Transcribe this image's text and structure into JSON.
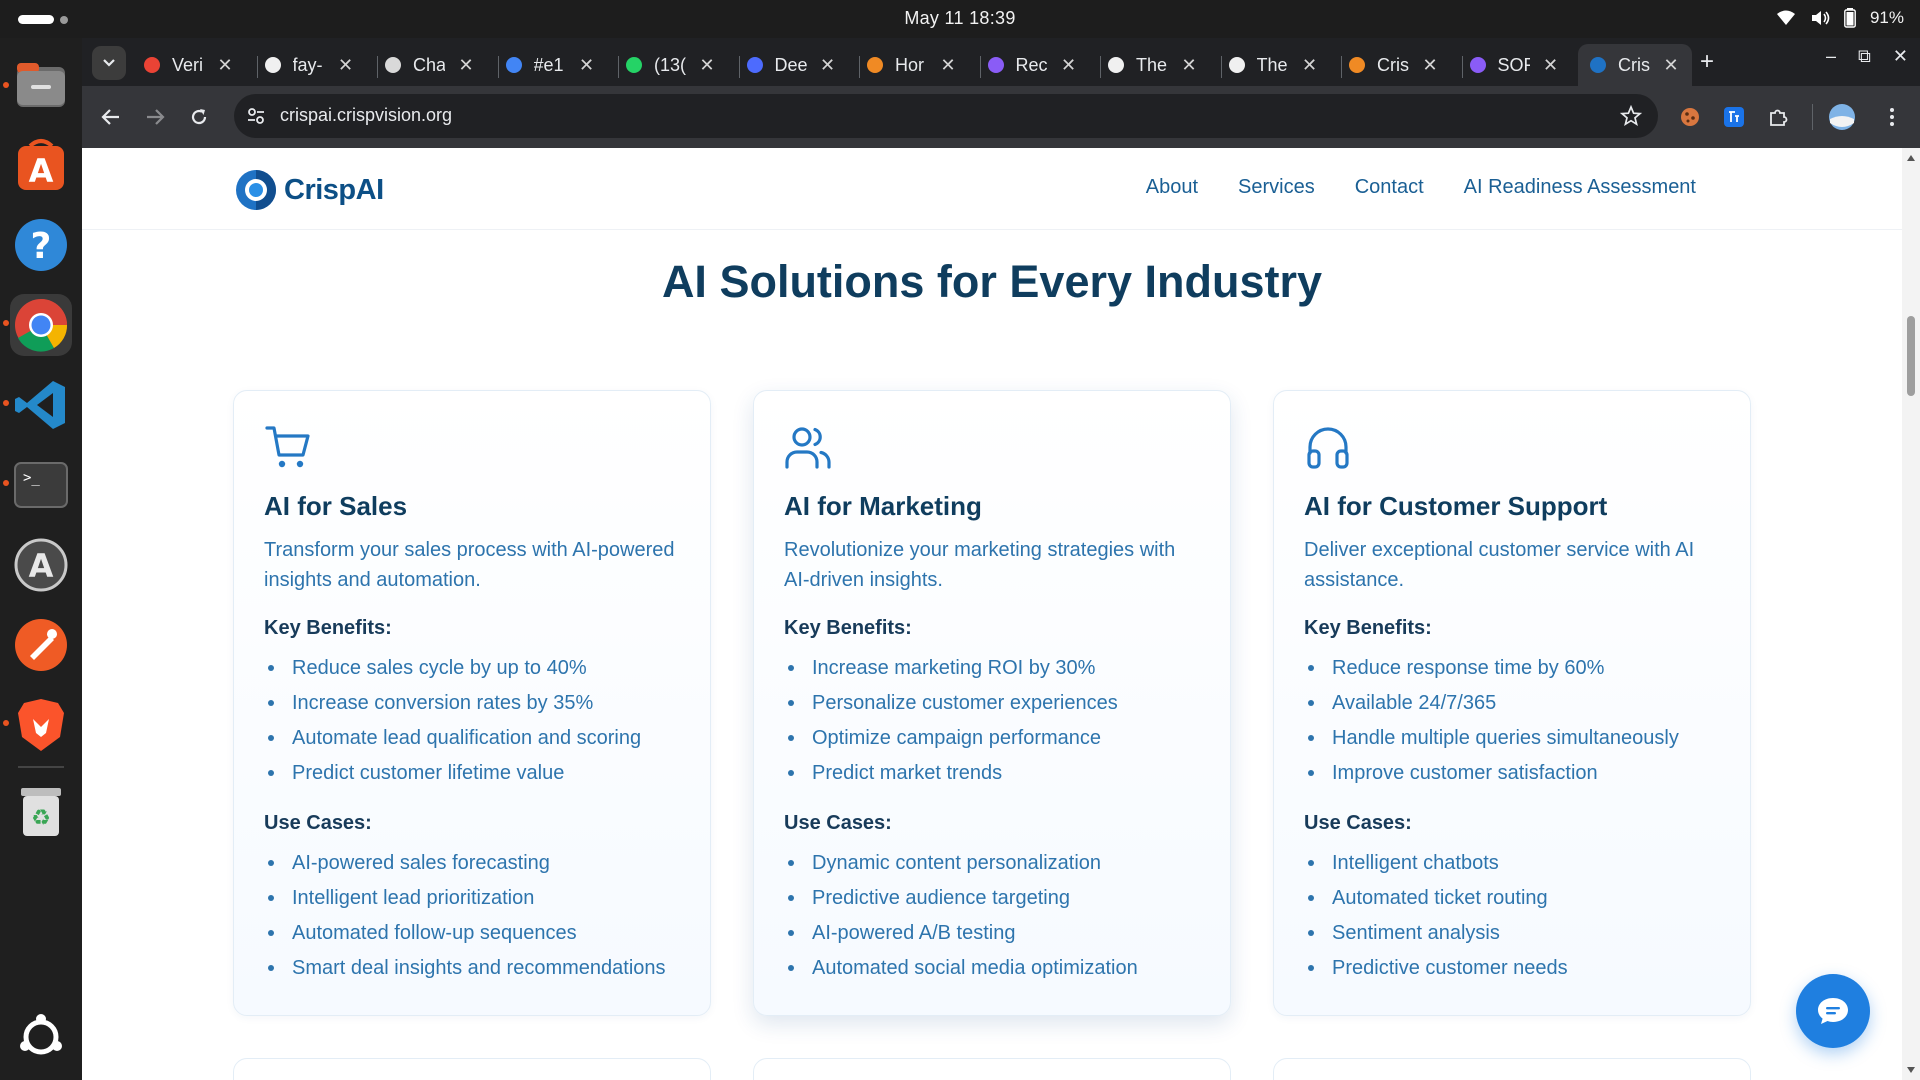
{
  "system": {
    "clock": "May 11  18:39",
    "battery": "91%"
  },
  "browser": {
    "tabs": [
      {
        "title": "Veri",
        "icon": "gmail-icon"
      },
      {
        "title": "fay-",
        "icon": "github-icon"
      },
      {
        "title": "Cha",
        "icon": "chatgpt-icon"
      },
      {
        "title": "#e1",
        "icon": "google-icon"
      },
      {
        "title": "(13(",
        "icon": "whatsapp-icon"
      },
      {
        "title": "Dee",
        "icon": "deepseek-icon"
      },
      {
        "title": "Hor",
        "icon": "site-icon"
      },
      {
        "title": "Rec",
        "icon": "purple-app-icon"
      },
      {
        "title": "The",
        "icon": "chat-bubble-icon"
      },
      {
        "title": "The",
        "icon": "chat-bubble-icon"
      },
      {
        "title": "Cris",
        "icon": "site-icon"
      },
      {
        "title": "SOF",
        "icon": "purple-app-icon"
      },
      {
        "title": "Cris",
        "icon": "crispai-icon",
        "active": true
      }
    ],
    "url": "crispai.crispvision.org"
  },
  "site": {
    "logo_text": "CrispAI",
    "nav": [
      "About",
      "Services",
      "Contact",
      "AI Readiness Assessment"
    ],
    "section_title": "AI Solutions for Every Industry",
    "benefits_heading": "Key Benefits:",
    "usecases_heading": "Use Cases:",
    "cards": [
      {
        "icon": "cart-icon",
        "title": "AI for Sales",
        "description": "Transform your sales process with AI-powered insights and automation.",
        "benefits": [
          "Reduce sales cycle by up to 40%",
          "Increase conversion rates by 35%",
          "Automate lead qualification and scoring",
          "Predict customer lifetime value"
        ],
        "use_cases": [
          "AI-powered sales forecasting",
          "Intelligent lead prioritization",
          "Automated follow-up sequences",
          "Smart deal insights and recommendations"
        ]
      },
      {
        "icon": "users-icon",
        "title": "AI for Marketing",
        "description": "Revolutionize your marketing strategies with AI-driven insights.",
        "benefits": [
          "Increase marketing ROI by 30%",
          "Personalize customer experiences",
          "Optimize campaign performance",
          "Predict market trends"
        ],
        "use_cases": [
          "Dynamic content personalization",
          "Predictive audience targeting",
          "AI-powered A/B testing",
          "Automated social media optimization"
        ]
      },
      {
        "icon": "headphones-icon",
        "title": "AI for Customer Support",
        "description": "Deliver exceptional customer service with AI assistance.",
        "benefits": [
          "Reduce response time by 60%",
          "Available 24/7/365",
          "Handle multiple queries simultaneously",
          "Improve customer satisfaction"
        ],
        "use_cases": [
          "Intelligent chatbots",
          "Automated ticket routing",
          "Sentiment analysis",
          "Predictive customer needs"
        ]
      }
    ]
  },
  "colors": {
    "brand_dark": "#0f3d5e",
    "brand_link": "#1a5f94",
    "body_blue": "#2d74ad",
    "chat_button": "#1f7fe0"
  }
}
